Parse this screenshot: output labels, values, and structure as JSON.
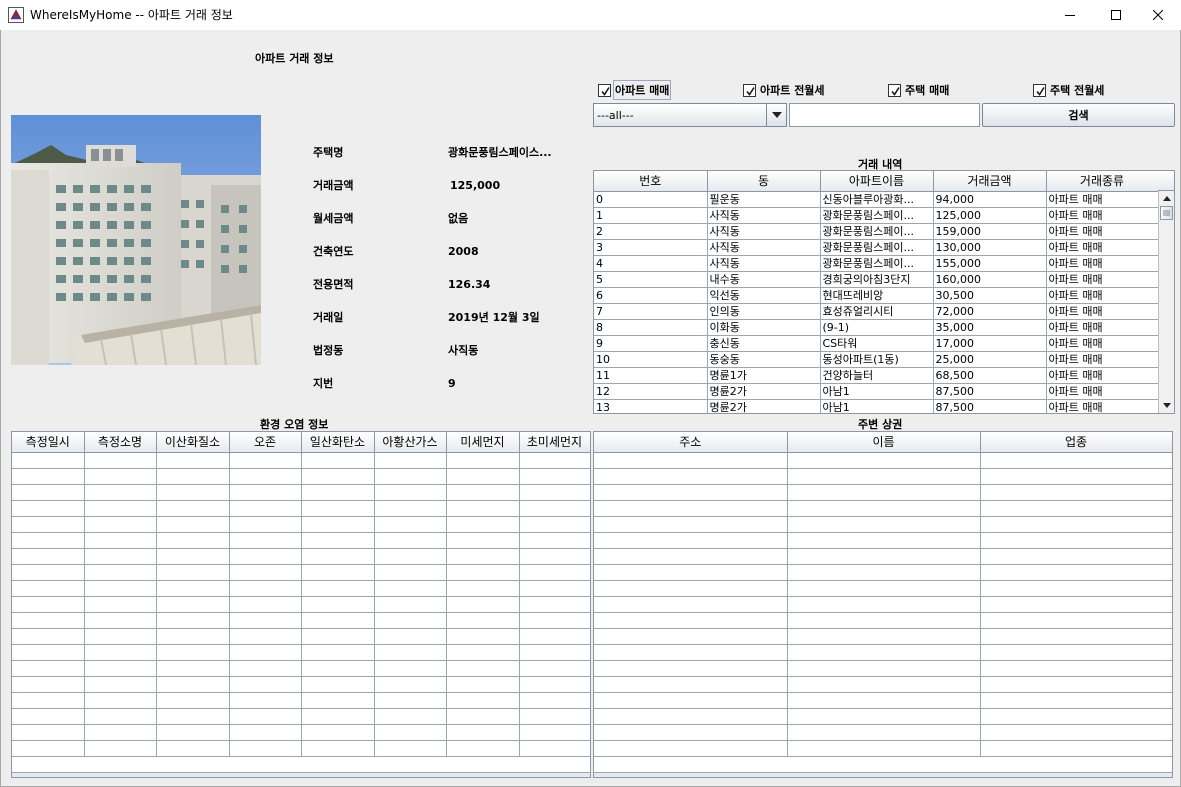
{
  "window": {
    "title": "WhereIsMyHome -- 아파트 거래 정보"
  },
  "header": {
    "title": "아파트 거래 정보"
  },
  "filters": {
    "checkboxes": [
      {
        "label": "아파트 매매",
        "checked": true
      },
      {
        "label": "아파트 전월세",
        "checked": true
      },
      {
        "label": "주택 매매",
        "checked": true
      },
      {
        "label": "주택 전월세",
        "checked": true
      }
    ],
    "dong_select": "---all---",
    "keyword": "",
    "search_label": "검색"
  },
  "detail": {
    "rows": [
      {
        "label": "주택명",
        "value": "광화문풍림스페이스..."
      },
      {
        "label": "거래금액",
        "value": "125,000"
      },
      {
        "label": "월세금액",
        "value": "없음"
      },
      {
        "label": "건축연도",
        "value": "2008"
      },
      {
        "label": "전용면적",
        "value": "126.34"
      },
      {
        "label": "거래일",
        "value": "2019년 12월 3일"
      },
      {
        "label": "법정동",
        "value": "사직동"
      },
      {
        "label": "지번",
        "value": "9"
      }
    ]
  },
  "deals": {
    "caption": "거래 내역",
    "columns": [
      "번호",
      "동",
      "아파트이름",
      "거래금액",
      "거래종류"
    ],
    "rows": [
      [
        "0",
        "필운동",
        "신동아블루아광화...",
        "94,000",
        "아파트 매매"
      ],
      [
        "1",
        "사직동",
        "광화문풍림스페이...",
        "125,000",
        "아파트 매매"
      ],
      [
        "2",
        "사직동",
        "광화문풍림스페이...",
        "159,000",
        "아파트 매매"
      ],
      [
        "3",
        "사직동",
        "광화문풍림스페이...",
        "130,000",
        "아파트 매매"
      ],
      [
        "4",
        "사직동",
        "광화문풍림스페이...",
        "155,000",
        "아파트 매매"
      ],
      [
        "5",
        "내수동",
        "경희궁의아침3단지",
        "160,000",
        "아파트 매매"
      ],
      [
        "6",
        "익선동",
        "현대뜨레비앙",
        "30,500",
        "아파트 매매"
      ],
      [
        "7",
        "인의동",
        "효성쥬얼리시티",
        "72,000",
        "아파트 매매"
      ],
      [
        "8",
        "이화동",
        "(9-1)",
        "35,000",
        "아파트 매매"
      ],
      [
        "9",
        "충신동",
        "CS타워",
        "17,000",
        "아파트 매매"
      ],
      [
        "10",
        "동숭동",
        "동성아파트(1동)",
        "25,000",
        "아파트 매매"
      ],
      [
        "11",
        "명륜1가",
        "건양하늘터",
        "68,500",
        "아파트 매매"
      ],
      [
        "12",
        "명륜2가",
        "아남1",
        "87,500",
        "아파트 매매"
      ],
      [
        "13",
        "명륜2가",
        "아남1",
        "87,500",
        "아파트 매매"
      ]
    ],
    "scroll_position": 0.0
  },
  "pollution": {
    "caption": "환경 오염 정보",
    "columns": [
      "측정일시",
      "측정소명",
      "이산화질소",
      "오존",
      "일산화탄소",
      "아황산가스",
      "미세먼지",
      "초미세먼지"
    ]
  },
  "commerce": {
    "caption": "주변 상권",
    "columns": [
      "주소",
      "이름",
      "업종"
    ]
  }
}
